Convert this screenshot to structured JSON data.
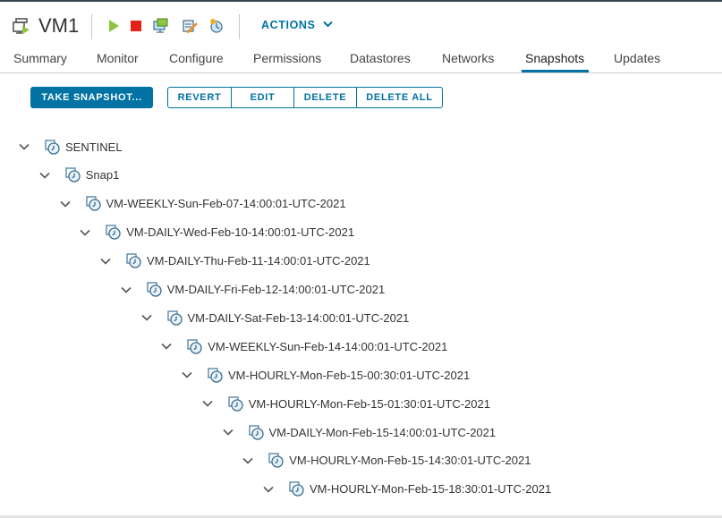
{
  "header": {
    "vm_name": "VM1",
    "actions_label": "ACTIONS"
  },
  "tabs": [
    {
      "label": "Summary"
    },
    {
      "label": "Monitor"
    },
    {
      "label": "Configure"
    },
    {
      "label": "Permissions"
    },
    {
      "label": "Datastores"
    },
    {
      "label": "Networks"
    },
    {
      "label": "Snapshots",
      "active": true
    },
    {
      "label": "Updates"
    }
  ],
  "toolbar": {
    "take_snapshot": "TAKE SNAPSHOT...",
    "revert": "REVERT",
    "edit": "EDIT",
    "delete": "DELETE",
    "delete_all": "DELETE ALL"
  },
  "tree": [
    {
      "label": "SENTINEL"
    },
    {
      "label": "Snap1"
    },
    {
      "label": "VM-WEEKLY-Sun-Feb-07-14:00:01-UTC-2021"
    },
    {
      "label": "VM-DAILY-Wed-Feb-10-14:00:01-UTC-2021"
    },
    {
      "label": "VM-DAILY-Thu-Feb-11-14:00:01-UTC-2021"
    },
    {
      "label": "VM-DAILY-Fri-Feb-12-14:00:01-UTC-2021"
    },
    {
      "label": "VM-DAILY-Sat-Feb-13-14:00:01-UTC-2021"
    },
    {
      "label": "VM-WEEKLY-Sun-Feb-14-14:00:01-UTC-2021"
    },
    {
      "label": "VM-HOURLY-Mon-Feb-15-00:30:01-UTC-2021"
    },
    {
      "label": "VM-HOURLY-Mon-Feb-15-01:30:01-UTC-2021"
    },
    {
      "label": "VM-DAILY-Mon-Feb-15-14:00:01-UTC-2021"
    },
    {
      "label": "VM-HOURLY-Mon-Feb-15-14:30:01-UTC-2021"
    },
    {
      "label": "VM-HOURLY-Mon-Feb-15-18:30:01-UTC-2021"
    }
  ],
  "colors": {
    "accent": "#0072a3",
    "power_on": "#8cc63f",
    "power_off": "#e2231a"
  },
  "icons": [
    "vm-icon",
    "power-on-icon",
    "power-off-icon",
    "console-icon",
    "migrate-icon",
    "snapshot-icon",
    "chevron-down-icon"
  ]
}
